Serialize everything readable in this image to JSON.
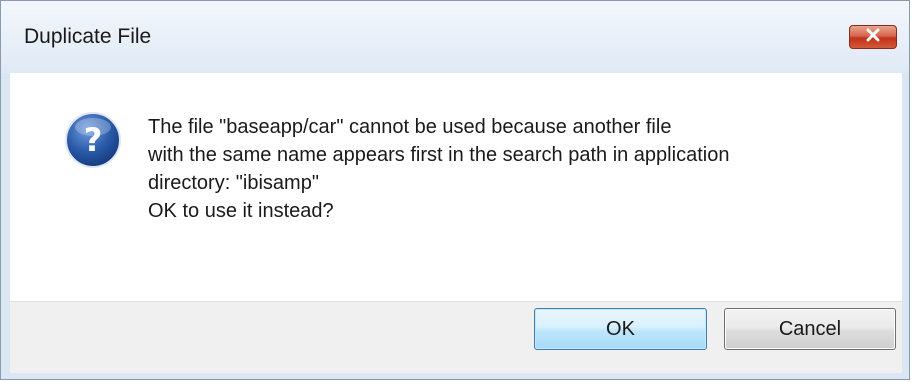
{
  "window": {
    "title": "Duplicate File"
  },
  "message": {
    "lines": [
      "The file \"baseapp/car\" cannot be used because another file",
      "with the same name appears first in the search path in application",
      "directory: \"ibisamp\"",
      "OK to use it instead?"
    ]
  },
  "buttons": {
    "ok_label": "OK",
    "cancel_label": "Cancel"
  },
  "icons": {
    "dialog_icon": "question-icon",
    "close": "close-icon"
  },
  "colors": {
    "titlebar": "#dfe9f5",
    "close_button": "#c7422a",
    "default_button_border": "#3c7fb1",
    "question_icon": "#2a5aa8"
  }
}
